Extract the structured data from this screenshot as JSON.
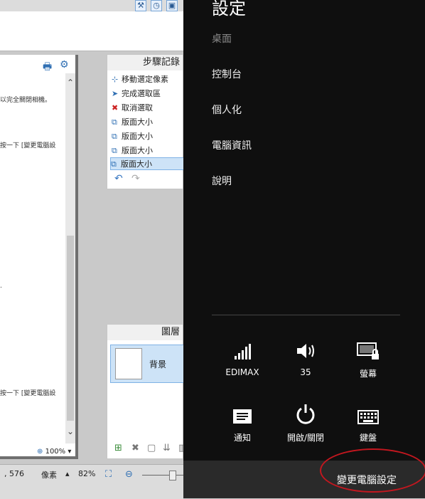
{
  "doc": {
    "line1": "以完全關閉相機。",
    "line2": "按一下 [變更電腦設",
    "line3": "按一下 [變更電腦設",
    "zoom": "100%"
  },
  "steps_panel": {
    "title": "步驟記錄",
    "items": [
      {
        "label": "移動選定像素"
      },
      {
        "label": "完成選取區"
      },
      {
        "label": "取消選取"
      },
      {
        "label": "版面大小"
      },
      {
        "label": "版面大小"
      },
      {
        "label": "版面大小"
      },
      {
        "label": "版面大小",
        "selected": true
      }
    ]
  },
  "layers_panel": {
    "title": "圖層",
    "layer_name": "背景"
  },
  "statusbar": {
    "coord": ", 576",
    "unit": "像素",
    "zoom": "82%"
  },
  "charm": {
    "title": "設定",
    "menu": [
      "桌面",
      "控制台",
      "個人化",
      "電腦資訊",
      "說明"
    ],
    "quick": [
      {
        "icon": "wifi-icon",
        "label": "EDIMAX"
      },
      {
        "icon": "speaker-icon",
        "label": "35"
      },
      {
        "icon": "screen-lock-icon",
        "label": "螢幕"
      },
      {
        "icon": "notification-icon",
        "label": "通知"
      },
      {
        "icon": "power-icon",
        "label": "開啟/關閉"
      },
      {
        "icon": "keyboard-icon",
        "label": "鍵盤"
      }
    ],
    "change_settings": "變更電腦設定",
    "annotation_color": "#c3171f"
  }
}
